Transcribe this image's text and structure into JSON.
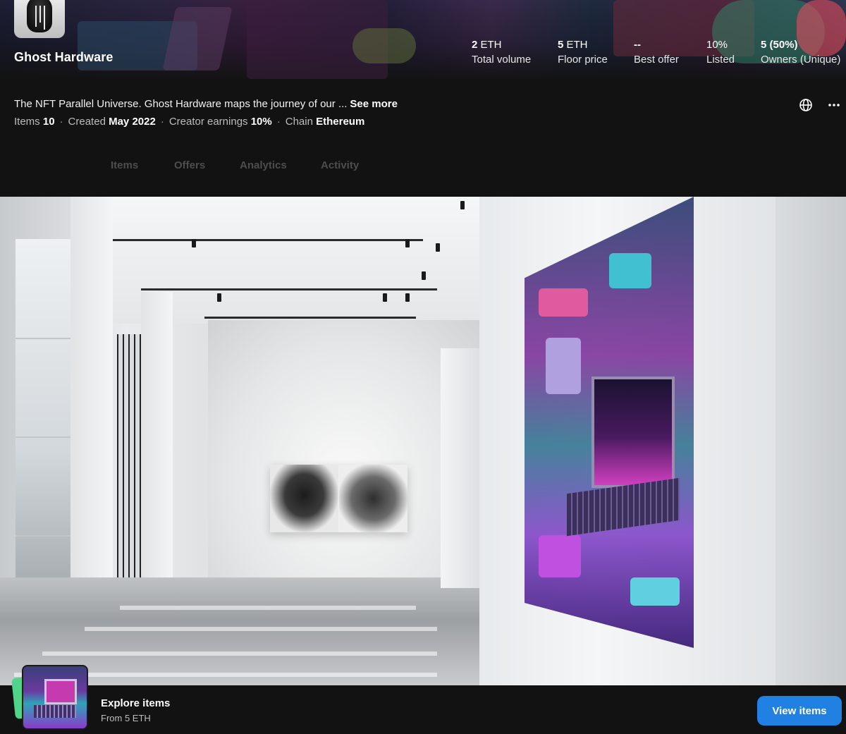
{
  "collection": {
    "name": "Ghost Hardware",
    "description": "The NFT Parallel Universe. Ghost Hardware maps the journey of our ...",
    "see_more_label": "See more"
  },
  "stats": [
    {
      "value": "2",
      "unit": " ETH",
      "label": "Total volume"
    },
    {
      "value": "5",
      "unit": " ETH",
      "label": "Floor price"
    },
    {
      "value": "--",
      "unit": "",
      "label": "Best offer"
    },
    {
      "value": "10%",
      "unit": "",
      "label": "Listed"
    },
    {
      "value": "5 (50%)",
      "unit": "",
      "label": "Owners (Unique)"
    }
  ],
  "meta": {
    "items_label": "Items",
    "items_value": "10",
    "created_label": "Created",
    "created_value": "May 2022",
    "earnings_label": "Creator earnings",
    "earnings_value": "10%",
    "chain_label": "Chain",
    "chain_value": "Ethereum",
    "separator": "·"
  },
  "tabs": [
    {
      "label": "Items"
    },
    {
      "label": "Offers"
    },
    {
      "label": "Analytics"
    },
    {
      "label": "Activity"
    }
  ],
  "bottom_bar": {
    "title": "Explore items",
    "subtitle": "From 5 ETH",
    "button_label": "View items"
  },
  "colors": {
    "background": "#121212",
    "accent": "#2081e2",
    "tab_inactive": "#4d4d4d"
  },
  "icons": [
    "globe-icon",
    "more-options-icon"
  ]
}
